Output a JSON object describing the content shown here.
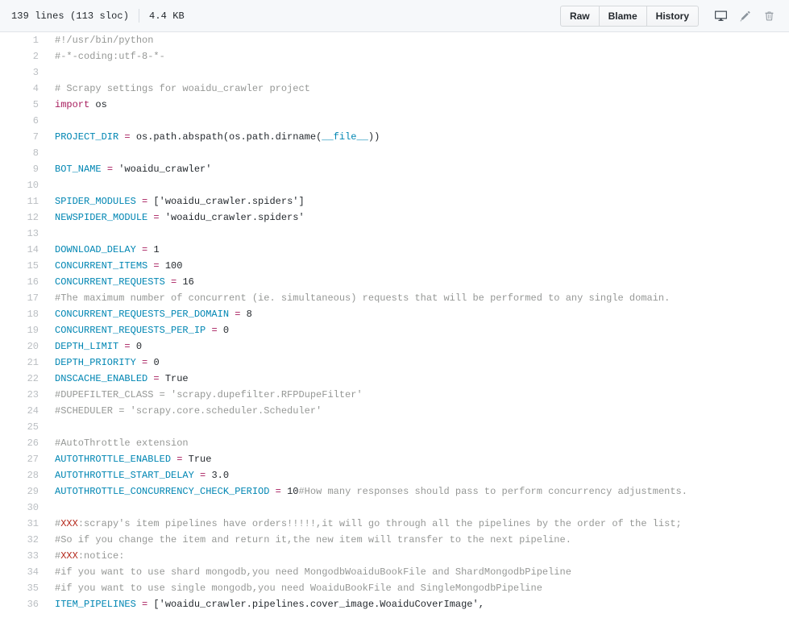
{
  "header": {
    "lines_text": "139 lines (113 sloc)",
    "size_text": "4.4 KB",
    "buttons": [
      {
        "label": "Raw",
        "name": "raw-button"
      },
      {
        "label": "Blame",
        "name": "blame-button"
      },
      {
        "label": "History",
        "name": "history-button"
      }
    ],
    "icons": [
      {
        "name": "desktop-icon",
        "title": "Open this file in GitHub Desktop"
      },
      {
        "name": "pencil-icon",
        "title": "Edit this file"
      },
      {
        "name": "trash-icon",
        "title": "Delete this file"
      }
    ]
  },
  "colors": {
    "header_bg": "#f6f8fa",
    "border": "#e1e4e8",
    "text": "#24292e",
    "line_number": "#babec2",
    "comment": "#969896",
    "keyword": "#a71d5d",
    "constant": "#0086b3",
    "todo": "#b52a1d"
  },
  "code": {
    "lines": [
      {
        "num": 1,
        "tokens": [
          {
            "t": "#!/usr/bin/python",
            "c": "c"
          }
        ]
      },
      {
        "num": 2,
        "tokens": [
          {
            "t": "#-*-coding:utf-8-*-",
            "c": "c"
          }
        ]
      },
      {
        "num": 3,
        "tokens": []
      },
      {
        "num": 4,
        "tokens": [
          {
            "t": "# Scrapy settings for woaidu_crawler project",
            "c": "c"
          }
        ]
      },
      {
        "num": 5,
        "tokens": [
          {
            "t": "import",
            "c": "k"
          },
          {
            "t": " os",
            "c": "pl"
          }
        ]
      },
      {
        "num": 6,
        "tokens": []
      },
      {
        "num": 7,
        "tokens": [
          {
            "t": "PROJECT_DIR",
            "c": "cst"
          },
          {
            "t": " ",
            "c": "pl"
          },
          {
            "t": "=",
            "c": "op"
          },
          {
            "t": " os.path.abspath(os.path.dirname(",
            "c": "pl"
          },
          {
            "t": "__file__",
            "c": "cst"
          },
          {
            "t": "))",
            "c": "pl"
          }
        ]
      },
      {
        "num": 8,
        "tokens": []
      },
      {
        "num": 9,
        "tokens": [
          {
            "t": "BOT_NAME",
            "c": "cst"
          },
          {
            "t": " ",
            "c": "pl"
          },
          {
            "t": "=",
            "c": "op"
          },
          {
            "t": " ",
            "c": "pl"
          },
          {
            "t": "'woaidu_crawler'",
            "c": "s"
          }
        ]
      },
      {
        "num": 10,
        "tokens": []
      },
      {
        "num": 11,
        "tokens": [
          {
            "t": "SPIDER_MODULES",
            "c": "cst"
          },
          {
            "t": " ",
            "c": "pl"
          },
          {
            "t": "=",
            "c": "op"
          },
          {
            "t": " [",
            "c": "pl"
          },
          {
            "t": "'woaidu_crawler.spiders'",
            "c": "s"
          },
          {
            "t": "]",
            "c": "pl"
          }
        ]
      },
      {
        "num": 12,
        "tokens": [
          {
            "t": "NEWSPIDER_MODULE",
            "c": "cst"
          },
          {
            "t": " ",
            "c": "pl"
          },
          {
            "t": "=",
            "c": "op"
          },
          {
            "t": " ",
            "c": "pl"
          },
          {
            "t": "'woaidu_crawler.spiders'",
            "c": "s"
          }
        ]
      },
      {
        "num": 13,
        "tokens": []
      },
      {
        "num": 14,
        "tokens": [
          {
            "t": "DOWNLOAD_DELAY",
            "c": "cst"
          },
          {
            "t": " ",
            "c": "pl"
          },
          {
            "t": "=",
            "c": "op"
          },
          {
            "t": " ",
            "c": "pl"
          },
          {
            "t": "1",
            "c": "n"
          }
        ]
      },
      {
        "num": 15,
        "tokens": [
          {
            "t": "CONCURRENT_ITEMS",
            "c": "cst"
          },
          {
            "t": " ",
            "c": "pl"
          },
          {
            "t": "=",
            "c": "op"
          },
          {
            "t": " ",
            "c": "pl"
          },
          {
            "t": "100",
            "c": "n"
          }
        ]
      },
      {
        "num": 16,
        "tokens": [
          {
            "t": "CONCURRENT_REQUESTS",
            "c": "cst"
          },
          {
            "t": " ",
            "c": "pl"
          },
          {
            "t": "=",
            "c": "op"
          },
          {
            "t": " ",
            "c": "pl"
          },
          {
            "t": "16",
            "c": "n"
          }
        ]
      },
      {
        "num": 17,
        "tokens": [
          {
            "t": "#The maximum number of concurrent (ie. simultaneous) requests that will be performed to any single domain.",
            "c": "c"
          }
        ]
      },
      {
        "num": 18,
        "tokens": [
          {
            "t": "CONCURRENT_REQUESTS_PER_DOMAIN",
            "c": "cst"
          },
          {
            "t": " ",
            "c": "pl"
          },
          {
            "t": "=",
            "c": "op"
          },
          {
            "t": " ",
            "c": "pl"
          },
          {
            "t": "8",
            "c": "n"
          }
        ]
      },
      {
        "num": 19,
        "tokens": [
          {
            "t": "CONCURRENT_REQUESTS_PER_IP",
            "c": "cst"
          },
          {
            "t": " ",
            "c": "pl"
          },
          {
            "t": "=",
            "c": "op"
          },
          {
            "t": " ",
            "c": "pl"
          },
          {
            "t": "0",
            "c": "n"
          }
        ]
      },
      {
        "num": 20,
        "tokens": [
          {
            "t": "DEPTH_LIMIT",
            "c": "cst"
          },
          {
            "t": " ",
            "c": "pl"
          },
          {
            "t": "=",
            "c": "op"
          },
          {
            "t": " ",
            "c": "pl"
          },
          {
            "t": "0",
            "c": "n"
          }
        ]
      },
      {
        "num": 21,
        "tokens": [
          {
            "t": "DEPTH_PRIORITY",
            "c": "cst"
          },
          {
            "t": " ",
            "c": "pl"
          },
          {
            "t": "=",
            "c": "op"
          },
          {
            "t": " ",
            "c": "pl"
          },
          {
            "t": "0",
            "c": "n"
          }
        ]
      },
      {
        "num": 22,
        "tokens": [
          {
            "t": "DNSCACHE_ENABLED",
            "c": "cst"
          },
          {
            "t": " ",
            "c": "pl"
          },
          {
            "t": "=",
            "c": "op"
          },
          {
            "t": " True",
            "c": "pl"
          }
        ]
      },
      {
        "num": 23,
        "tokens": [
          {
            "t": "#DUPEFILTER_CLASS = 'scrapy.dupefilter.RFPDupeFilter'",
            "c": "c"
          }
        ]
      },
      {
        "num": 24,
        "tokens": [
          {
            "t": "#SCHEDULER = 'scrapy.core.scheduler.Scheduler'",
            "c": "c"
          }
        ]
      },
      {
        "num": 25,
        "tokens": []
      },
      {
        "num": 26,
        "tokens": [
          {
            "t": "#AutoThrottle extension",
            "c": "c"
          }
        ]
      },
      {
        "num": 27,
        "tokens": [
          {
            "t": "AUTOTHROTTLE_ENABLED",
            "c": "cst"
          },
          {
            "t": " ",
            "c": "pl"
          },
          {
            "t": "=",
            "c": "op"
          },
          {
            "t": " True",
            "c": "pl"
          }
        ]
      },
      {
        "num": 28,
        "tokens": [
          {
            "t": "AUTOTHROTTLE_START_DELAY",
            "c": "cst"
          },
          {
            "t": " ",
            "c": "pl"
          },
          {
            "t": "=",
            "c": "op"
          },
          {
            "t": " ",
            "c": "pl"
          },
          {
            "t": "3.0",
            "c": "n"
          }
        ]
      },
      {
        "num": 29,
        "tokens": [
          {
            "t": "AUTOTHROTTLE_CONCURRENCY_CHECK_PERIOD",
            "c": "cst"
          },
          {
            "t": " ",
            "c": "pl"
          },
          {
            "t": "=",
            "c": "op"
          },
          {
            "t": " ",
            "c": "pl"
          },
          {
            "t": "10",
            "c": "n"
          },
          {
            "t": "#How many responses should pass to perform concurrency adjustments.",
            "c": "c"
          }
        ]
      },
      {
        "num": 30,
        "tokens": []
      },
      {
        "num": 31,
        "tokens": [
          {
            "t": "#",
            "c": "c"
          },
          {
            "t": "XXX",
            "c": "todo"
          },
          {
            "t": ":scrapy's item pipelines have orders!!!!!,it will go through all the pipelines by the order of the list;",
            "c": "c"
          }
        ]
      },
      {
        "num": 32,
        "tokens": [
          {
            "t": "#So if you change the item and return it,the new item will transfer to the next pipeline.",
            "c": "c"
          }
        ]
      },
      {
        "num": 33,
        "tokens": [
          {
            "t": "#",
            "c": "c"
          },
          {
            "t": "XXX",
            "c": "todo"
          },
          {
            "t": ":notice:",
            "c": "c"
          }
        ]
      },
      {
        "num": 34,
        "tokens": [
          {
            "t": "#if you want to use shard mongodb,you need MongodbWoaiduBookFile and ShardMongodbPipeline",
            "c": "c"
          }
        ]
      },
      {
        "num": 35,
        "tokens": [
          {
            "t": "#if you want to use single mongodb,you need WoaiduBookFile and SingleMongodbPipeline",
            "c": "c"
          }
        ]
      },
      {
        "num": 36,
        "tokens": [
          {
            "t": "ITEM_PIPELINES",
            "c": "cst"
          },
          {
            "t": " ",
            "c": "pl"
          },
          {
            "t": "=",
            "c": "op"
          },
          {
            "t": " [",
            "c": "pl"
          },
          {
            "t": "'woaidu_crawler.pipelines.cover_image.WoaiduCoverImage'",
            "c": "s"
          },
          {
            "t": ",",
            "c": "pl"
          }
        ]
      }
    ]
  }
}
